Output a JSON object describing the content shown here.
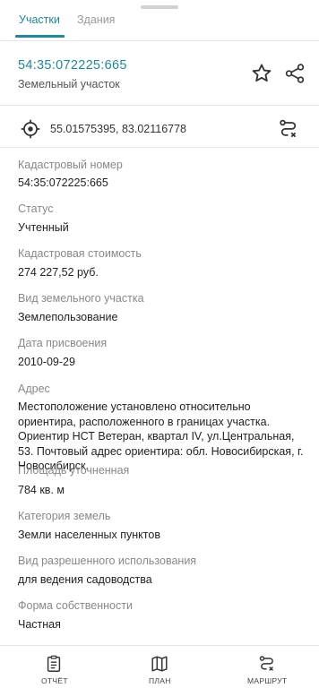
{
  "tabs": {
    "active": "Участки",
    "inactive": "Здания"
  },
  "header": {
    "cadastral_number": "54:35:072225:665",
    "object_type": "Земельный участок"
  },
  "coordinates": {
    "value": "55.01575395, 83.02116778"
  },
  "fields": [
    {
      "label": "Кадастровый номер",
      "value": "54:35:072225:665"
    },
    {
      "label": "Статус",
      "value": "Учтенный"
    },
    {
      "label": "Кадастровая стоимость",
      "value": "274 227,52 руб."
    },
    {
      "label": "Вид земельного участка",
      "value": "Землепользование"
    },
    {
      "label": "Дата присвоения",
      "value": "2010-09-29"
    },
    {
      "label": "Адрес",
      "value": "Местоположение установлено относительно ориентира, расположенного в границах участка. Ориентир НСТ Ветеран, квартал IV, ул.Центральная, 53. Почтовый адрес ориентира: обл. Новосибирская, г. Новосибирск."
    },
    {
      "label": "Площадь уточненная",
      "value": "784 кв. м"
    },
    {
      "label": "Категория земель",
      "value": "Земли населенных пунктов"
    },
    {
      "label": "Вид разрешенного использования",
      "value": "для ведения садоводства"
    },
    {
      "label": "Форма собственности",
      "value": "Частная"
    }
  ],
  "bottom_nav": {
    "report": "ОТЧЁТ",
    "plan": "ПЛАН",
    "route": "МАРШРУТ"
  },
  "colors": {
    "accent": "#1b8a9e",
    "label": "#888888",
    "text": "#222222"
  }
}
